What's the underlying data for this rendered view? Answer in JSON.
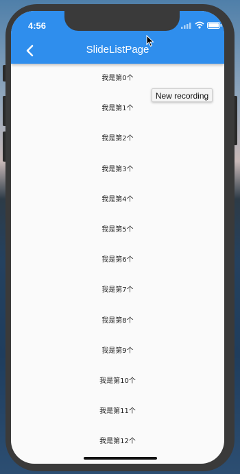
{
  "status_bar": {
    "time": "4:56"
  },
  "app_bar": {
    "title": "SlideListPage",
    "back_icon": "chevron-left-icon"
  },
  "list": {
    "items": [
      "我是第0个",
      "我是第1个",
      "我是第2个",
      "我是第3个",
      "我是第4个",
      "我是第5个",
      "我是第6个",
      "我是第7个",
      "我是第8个",
      "我是第9个",
      "我是第10个",
      "我是第11个",
      "我是第12个"
    ]
  },
  "tooltip": {
    "text": "New recording"
  },
  "colors": {
    "app_bar": "#2f8eed",
    "background": "#fafafa",
    "bezel": "#3a3a3a",
    "text": "#222222"
  }
}
